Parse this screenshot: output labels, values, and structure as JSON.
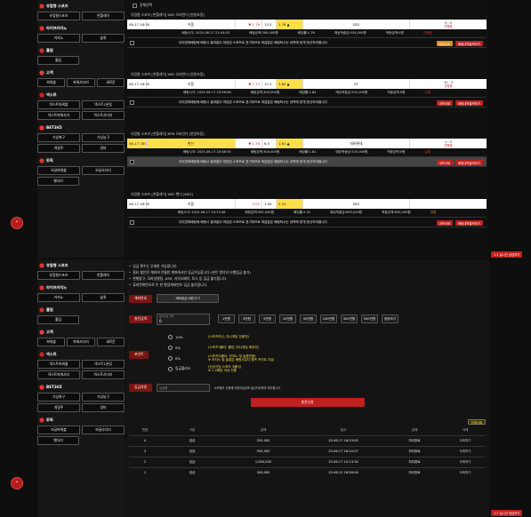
{
  "sidebar_top": {
    "sections": [
      {
        "title": "유럽형 스포츠",
        "rows": [
          [
            "유럽형스포츠",
            "한폴레이"
          ]
        ]
      },
      {
        "title": "라이브카지노",
        "rows": [
          [
            "카지노",
            "슬롯"
          ]
        ]
      },
      {
        "title": "홀덤",
        "rows": [
          [
            "홀덤"
          ]
        ]
      },
      {
        "title": "고객",
        "rows": [
          [
            "파워볼",
            "파워사다리",
            "새로운"
          ]
        ]
      },
      {
        "title": "넥스트",
        "rows": [
          [
            "넥스트파워볼",
            "넥스트1분링"
          ],
          [
            "넥스트파워사다",
            "넥스트사다리"
          ]
        ]
      },
      {
        "title": "BET365",
        "rows": [
          [
            "가상축구",
            "가상농구"
          ],
          [
            "개경주",
            "경마"
          ]
        ]
      },
      {
        "title": "토픽",
        "rows": [
          [
            "보글파워볼",
            "보글사다리"
          ],
          [
            "벨다리"
          ]
        ]
      }
    ]
  },
  "sidebar_bottom": {
    "sections": [
      {
        "title": "유럽형 스포츠",
        "rows": [
          [
            "유럽형스포츠",
            "한폴레이"
          ]
        ]
      },
      {
        "title": "라이브카지노",
        "rows": [
          [
            "카지노",
            "슬롯"
          ]
        ]
      },
      {
        "title": "홀덤",
        "rows": [
          [
            "홀덤"
          ]
        ]
      },
      {
        "title": "고객",
        "rows": [
          [
            "파워볼",
            "파워사다리",
            "새로운"
          ]
        ]
      },
      {
        "title": "넥스트",
        "rows": [
          [
            "넥스트파워볼",
            "넥스트1분링"
          ],
          [
            "넥스트파워사다",
            "넥스트사다리"
          ]
        ]
      },
      {
        "title": "BET365",
        "rows": [
          [
            "가상축구",
            "가상농구"
          ],
          [
            "개경주",
            "경마"
          ]
        ]
      },
      {
        "title": "토픽",
        "rows": [
          [
            "보글파워볼",
            "보글사다리"
          ],
          [
            "벨다리"
          ]
        ]
      }
    ]
  },
  "select_all": "전체선택",
  "bets": [
    {
      "title": "유럽형 스포츠 [한폴레이] KBO 오버언더 [한방포함]",
      "date": "06-17 18:30",
      "team1": "키움",
      "odd1": "▼ 1.79",
      "line": "13.5",
      "odd2": "1.76 ▲",
      "team2": "SSG",
      "score": "0 : 0",
      "result": "진행중",
      "info": [
        "배팅시각: 2025-06-17 21:43:03",
        "배팅금액:300,000원",
        "배당률:1.76",
        "예상적중금:534,000원",
        "적중금액:0원"
      ],
      "status": "진행중",
      "notice": "우리업체배팅에 배팅시 결과없이 마감된 스포츠로 표기되므로 마감없은 배팅하시는 내역에 맞게 정산처리됩니다",
      "buttons": [
        "배팅취소",
        "배팅내역출력하기"
      ]
    },
    {
      "title": "유럽형 스포츠 [한폴레이] KBO 오버언더 [한방포함]",
      "date": "06-17 18:30",
      "team1": "키움",
      "odd1": "▼ 1.73",
      "line": "12.5",
      "odd2": "1.84 ▲",
      "team2": "KT",
      "score": "10 : 3",
      "result": "진행중",
      "info": [
        "배팅시각: 2025-06-17 20:56:08",
        "배팅금액:300,000원",
        "배당률:1.84",
        "예상적중금:552,000원",
        "적중금액:0원"
      ],
      "status": "실패",
      "notice": "우리업체배팅에 배팅시 결과없이 마감된 스포츠로 표기되므로 마감없은 배팅하시는 내역에 맞게 정산처리됩니다",
      "buttons": [
        "내역삭제",
        "배팅내역출력하기"
      ]
    },
    {
      "title": "유럽형 스포츠 [한폴레이] NPB 오버언더 [한방포함]",
      "date": "06-17 18:00",
      "team1": "한신",
      "odd1": "▼ 1.76",
      "line": "6.5",
      "odd2": "1.81 ▲",
      "team2": "지바롯데",
      "score": "1 : 3",
      "result": "진행중",
      "info": [
        "배팅시각: 2025-06-17 20:48:54",
        "배팅금액:300,000원",
        "배당률:1.81",
        "예상적중금:525,000원",
        "적중금액:0원"
      ],
      "status": "실패",
      "notice": "우리업체배팅에 배팅시 결과없이 마감된 스포츠로 표기되므로 마감없은 배팅하시는 내역에 맞게 정산처리됩니다",
      "buttons": [
        "내역삭제",
        "배팅내역출력하기"
      ]
    },
    {
      "title": "유럽형 스포츠 [한폴레이] KBO 핸디 [KBO]",
      "date": "06-17 18:30",
      "team1": "키움",
      "odd1": "5.01",
      "line": "1.99",
      "odd2": "2.31",
      "team2": "SSG",
      "score": "",
      "result": "",
      "info": [
        "배팅시각: 2025-06-17 10:13:46",
        "배팅금액:300,000원",
        "배당률:2.31",
        "예상적중금:693,000원",
        "적중금액:693,000원"
      ],
      "status": "당첨",
      "notice": "우리업체배팅에 배팅시 결과없이 마감된 스포츠로 표기되므로 마감없은 배팅하시는 내역에 맞게 정산처리됩니다",
      "buttons": [
        "내역삭제",
        "배팅내역출력하기"
      ]
    }
  ],
  "live_chat": "1:1 실시간 상담하기",
  "deposit": {
    "notices": [
      "입금 횟수는 무제한 가능합니다.",
      "필요 할인된 계좌에 안될한 계좌에서만 입금가능합니다.(본인 명의의 타행입금 불가)",
      "현행창구, 모바일뱅킹, ATM, 카카오페이, 토스 등 입금 불가합니다.",
      "휴대전화번호로 인 한 평생계좌번호 입금 불가합니다."
    ],
    "account_label": "계좌번호",
    "account_button": "계좌발급 버튼가기",
    "amount_label": "충전금액",
    "amount_placeholder": "충전하실 금액",
    "amount_value": "0",
    "amounts": [
      "1만원",
      "3만원",
      "5만원",
      "10만원",
      "50만원",
      "100만원",
      "300만원",
      "500만원",
      "정정하기"
    ],
    "point_label": "포인트",
    "points": [
      {
        "value": "10%",
        "desc": "(스포츠미니, 미니게임 전용전)"
      },
      {
        "value": "0%",
        "desc": "(스포츠3폴더, 홀덤, 미니게임 제외전)"
      },
      {
        "value": "0%",
        "desc": "(스포츠다폴더, 카지노 및 슬롯전용)\n※ 카지노 및 슬롯은 배팅사유다 콤프 포인트 지급"
      },
      {
        "value": "입금플러스",
        "desc": "(신규가입 스포츠 3폴더)\n※ 1,5배당 이상 전용"
      }
    ],
    "depositor_label": "입금자명",
    "depositor_placeholder": "입금명",
    "depositor_note": "※보험무 신청해 허용지급상포 결산처리하여 처리합니다",
    "submit": "충전신청"
  },
  "history": {
    "delete_all": "전체삭제",
    "columns": [
      "번호",
      "구분",
      "금액",
      "일시",
      "상태",
      "삭제"
    ],
    "rows": [
      {
        "no": "4",
        "type": "입금",
        "amount": "500,000",
        "date": "25-06-17 16:23:50",
        "status": "처리완료",
        "action": "삭제하기"
      },
      {
        "no": "3",
        "type": "입금",
        "amount": "500,000",
        "date": "25-06-17 16:22:07",
        "status": "처리완료",
        "action": "삭제하기"
      },
      {
        "no": "2",
        "type": "입금",
        "amount": "1,000,000",
        "date": "25-06-17 10:13:34",
        "status": "처리완료",
        "action": "삭제하기"
      },
      {
        "no": "1",
        "type": "입금",
        "amount": "300,000",
        "date": "25-06-15 18:56:04",
        "status": "처리완료",
        "action": "삭제하기"
      }
    ]
  },
  "colors": {
    "accent": "#c0201e",
    "highlight": "#fde049",
    "orange": "#e38a1a"
  }
}
